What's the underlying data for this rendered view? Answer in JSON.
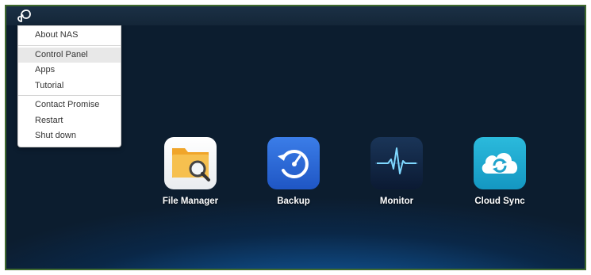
{
  "menu": {
    "items": [
      {
        "label": "About NAS"
      },
      {
        "label": "Control Panel"
      },
      {
        "label": "Apps"
      },
      {
        "label": "Tutorial"
      },
      {
        "label": "Contact Promise"
      },
      {
        "label": "Restart"
      },
      {
        "label": "Shut down"
      }
    ]
  },
  "desktop": {
    "apps": [
      {
        "label": "File Manager",
        "icon": "file-manager-icon"
      },
      {
        "label": "Backup",
        "icon": "backup-icon"
      },
      {
        "label": "Monitor",
        "icon": "monitor-icon"
      },
      {
        "label": "Cloud Sync",
        "icon": "cloud-sync-icon"
      }
    ]
  },
  "colors": {
    "frame_border": "#3f6a2e",
    "menu_highlight": "#e8e8e8",
    "backup_blue": "#2a67d6",
    "cloud_cyan": "#21aacf"
  }
}
